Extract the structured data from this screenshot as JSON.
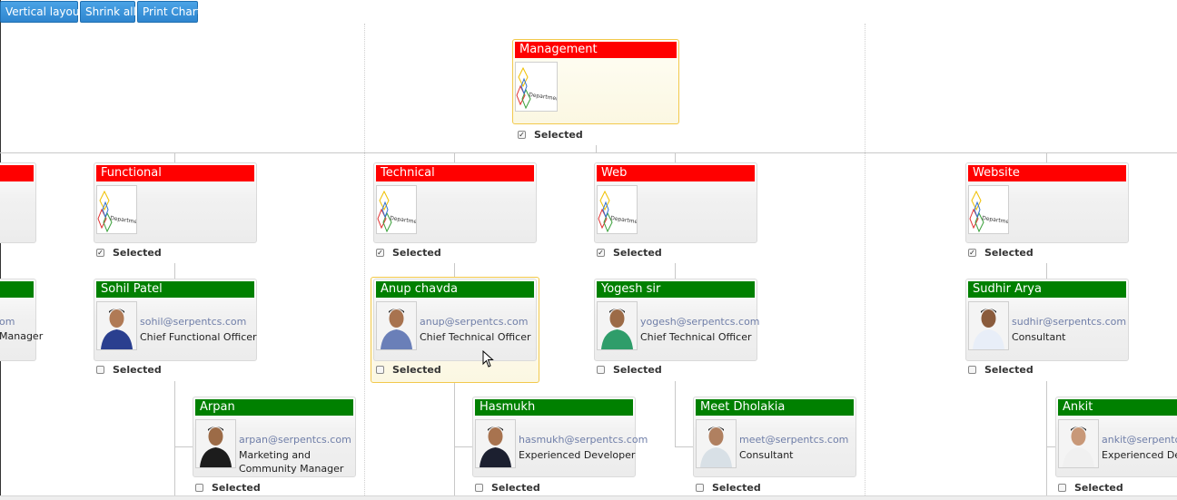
{
  "toolbar": {
    "vertical_layout": "Vertical layout",
    "shrink_all": "Shrink all",
    "print_chart": "Print Chart"
  },
  "logo_text": "Department",
  "root": {
    "title": "Management",
    "selected_label": "Selected",
    "checked": true
  },
  "departments": [
    {
      "title": "Functional",
      "selected_label": "Selected",
      "checked": true
    },
    {
      "title": "Technical",
      "selected_label": "Selected",
      "checked": true
    },
    {
      "title": "Web",
      "selected_label": "Selected",
      "checked": true
    },
    {
      "title": "Website",
      "selected_label": "Selected",
      "checked": true
    }
  ],
  "managers": [
    {
      "name": "Sohil Patel",
      "email": "sohil@serpentcs.com",
      "role": "Chief Functional Officer",
      "selected_label": "Selected"
    },
    {
      "name": "Anup chavda",
      "email": "anup@serpentcs.com",
      "role": "Chief Technical Officer",
      "selected_label": "Selected"
    },
    {
      "name": "Yogesh sir",
      "email": "yogesh@serpentcs.com",
      "role": "Chief Technical Officer",
      "selected_label": "Selected"
    },
    {
      "name": "Sudhir Arya",
      "email": "sudhir@serpentcs.com",
      "role": "Consultant",
      "selected_label": "Selected"
    }
  ],
  "staff": [
    {
      "name": "Arpan",
      "email": "arpan@serpentcs.com",
      "role": "Marketing and Community Manager",
      "selected_label": "Selected"
    },
    {
      "name": "Hasmukh",
      "email": "hasmukh@serpentcs.com",
      "role": "Experienced Developer",
      "selected_label": "Selected"
    },
    {
      "name": "Meet Dholakia",
      "email": "meet@serpentcs.com",
      "role": "Consultant",
      "selected_label": "Selected"
    },
    {
      "name": "Ankit",
      "email": "ankit@serpentcs.com",
      "role": "Experienced Developer",
      "selected_label": "Selected"
    }
  ],
  "partial_left": {
    "email_tail": "om",
    "role_tail": "Manager"
  },
  "colors": {
    "department_header": "#ff0000",
    "employee_header": "#008000",
    "email_text": "#6f7ea8",
    "highlight_border": "#f2c94c",
    "button": "#2f86cf"
  }
}
